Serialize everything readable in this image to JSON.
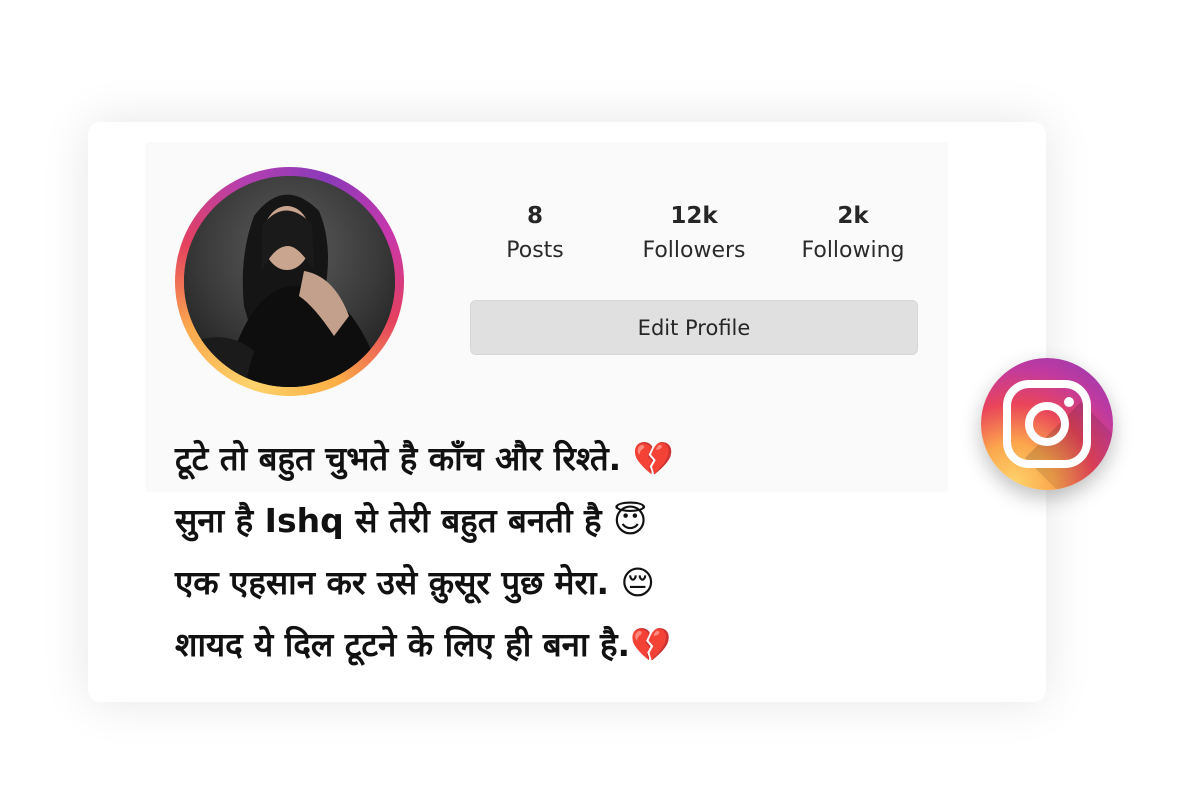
{
  "profile": {
    "stats": [
      {
        "value": "8",
        "label": "Posts"
      },
      {
        "value": "12k",
        "label": "Followers"
      },
      {
        "value": "2k",
        "label": "Following"
      }
    ],
    "edit_button_label": "Edit Profile",
    "avatar_icon": "profile-photo",
    "ring_colors": [
      "#fdd36b",
      "#fba94d",
      "#e4405f",
      "#b53fb0",
      "#8a3ab9"
    ]
  },
  "bio": {
    "lines": [
      "टूटे तो बहुत चुभते है काँच और रिश्ते. 💔",
      "सुना है Ishq से तेरी बहुत बनती है 😇",
      "एक एहसान कर उसे क़ुसूर पुछ मेरा. 😔",
      "शायद ये दिल टूटने के लिए ही बना है.💔"
    ]
  },
  "brand_badge": {
    "icon": "instagram-icon",
    "gradient": [
      "#fdd36b",
      "#fca74d",
      "#e9445a",
      "#c13a9e",
      "#8a3ab9"
    ]
  }
}
